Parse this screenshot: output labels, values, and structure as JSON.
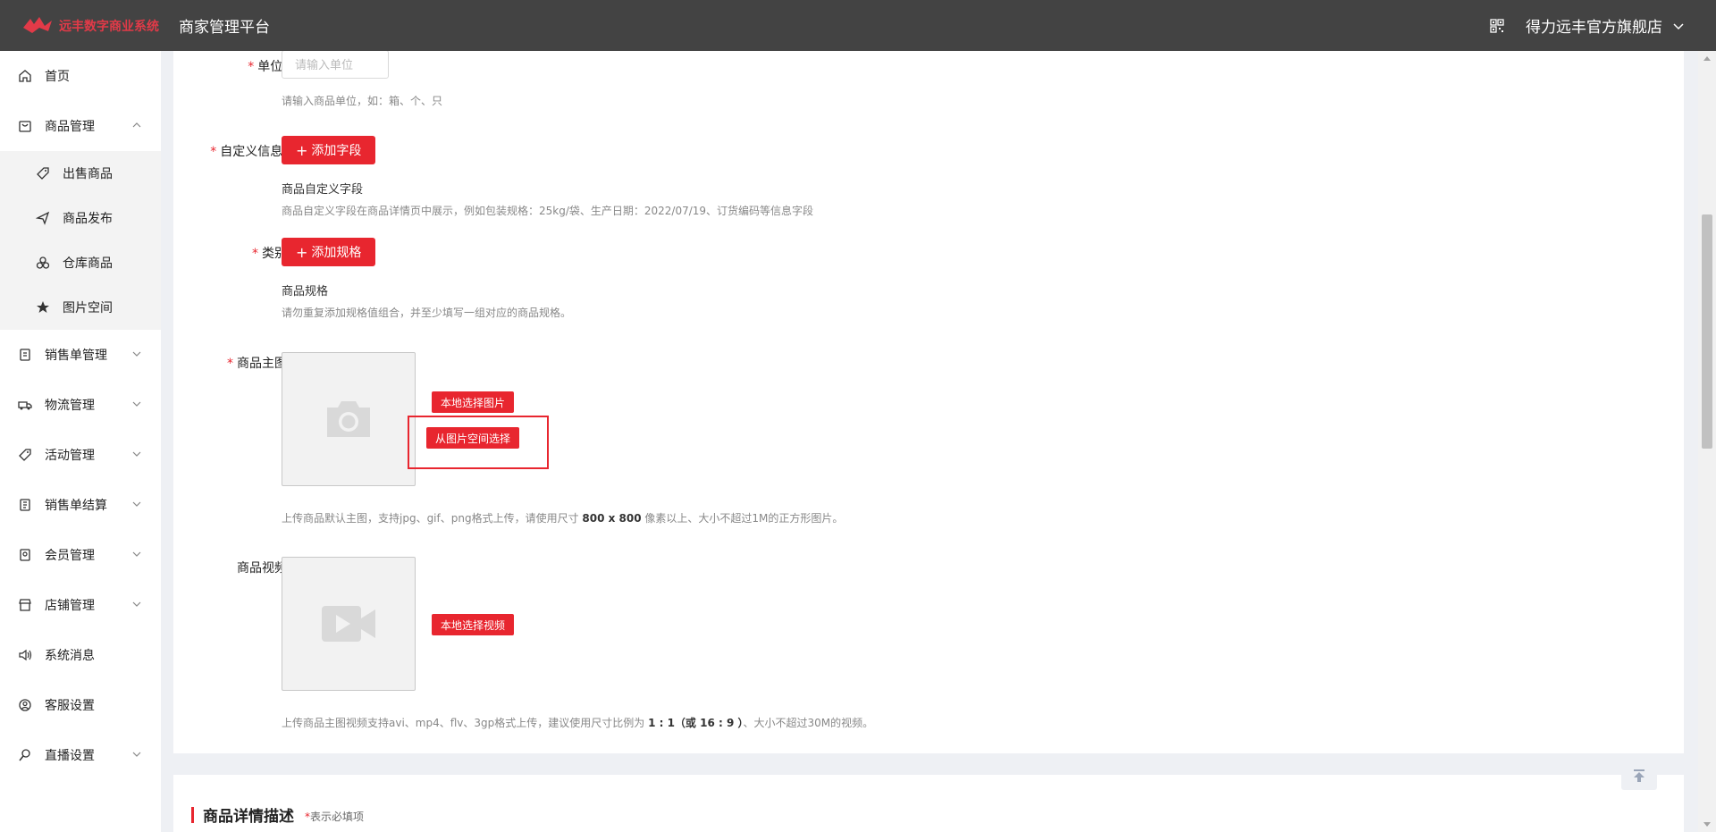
{
  "header": {
    "logo_text": "远丰数字商业系统",
    "platform_title": "商家管理平台",
    "store_name": "得力远丰官方旗舰店"
  },
  "sidebar": {
    "items": [
      {
        "label": "首页",
        "icon": "home-icon"
      },
      {
        "label": "商品管理",
        "icon": "goods-icon",
        "expanded": true
      },
      {
        "label": "销售单管理",
        "icon": "order-icon"
      },
      {
        "label": "物流管理",
        "icon": "truck-icon"
      },
      {
        "label": "活动管理",
        "icon": "tag-icon"
      },
      {
        "label": "销售单结算",
        "icon": "settle-icon"
      },
      {
        "label": "会员管理",
        "icon": "member-icon"
      },
      {
        "label": "店铺管理",
        "icon": "store-icon"
      },
      {
        "label": "系统消息",
        "icon": "speaker-icon"
      },
      {
        "label": "客服设置",
        "icon": "service-icon"
      },
      {
        "label": "直播设置",
        "icon": "live-icon"
      }
    ],
    "sub_items": [
      {
        "label": "出售商品",
        "icon": "tag-icon"
      },
      {
        "label": "商品发布",
        "icon": "send-icon"
      },
      {
        "label": "仓库商品",
        "icon": "warehouse-icon"
      },
      {
        "label": "图片空间",
        "icon": "star-icon"
      }
    ]
  },
  "form": {
    "unit": {
      "label": "单位:",
      "placeholder": "请输入单位",
      "hint": "请输入商品单位，如：箱、个、只"
    },
    "custom": {
      "label": "自定义信息:",
      "button": "添加字段",
      "subtitle": "商品自定义字段",
      "hint": "商品自定义字段在商品详情页中展示，例如包装规格：25kg/袋、生产日期：2022/07/19、订货编码等信息字段"
    },
    "category": {
      "label": "类别",
      "button": "添加规格",
      "subtitle": "商品规格",
      "hint": "请勿重复添加规格值组合，并至少填写一组对应的商品规格。"
    },
    "main_image": {
      "label": "商品主图",
      "btn_local": "本地选择图片",
      "btn_space": "从图片空间选择",
      "hint_pre": "上传商品默认主图，支持jpg、gif、png格式上传，请使用尺寸 ",
      "hint_size": "800 x 800",
      "hint_post": " 像素以上、大小不超过1M的正方形图片。"
    },
    "video": {
      "label": "商品视频",
      "btn_local": "本地选择视频",
      "hint_pre": "上传商品主图视频支持avi、mp4、flv、3gp格式上传，建议使用尺寸比例为 ",
      "hint_ratio": "1 : 1（或 16 : 9 ）",
      "hint_post": "、大小不超过30M的视频。"
    }
  },
  "detail_section": {
    "title": "商品详情描述",
    "note_star": "*",
    "note": "表示必填项"
  },
  "colors": {
    "accent": "#e8262f",
    "topbar": "#434343"
  }
}
